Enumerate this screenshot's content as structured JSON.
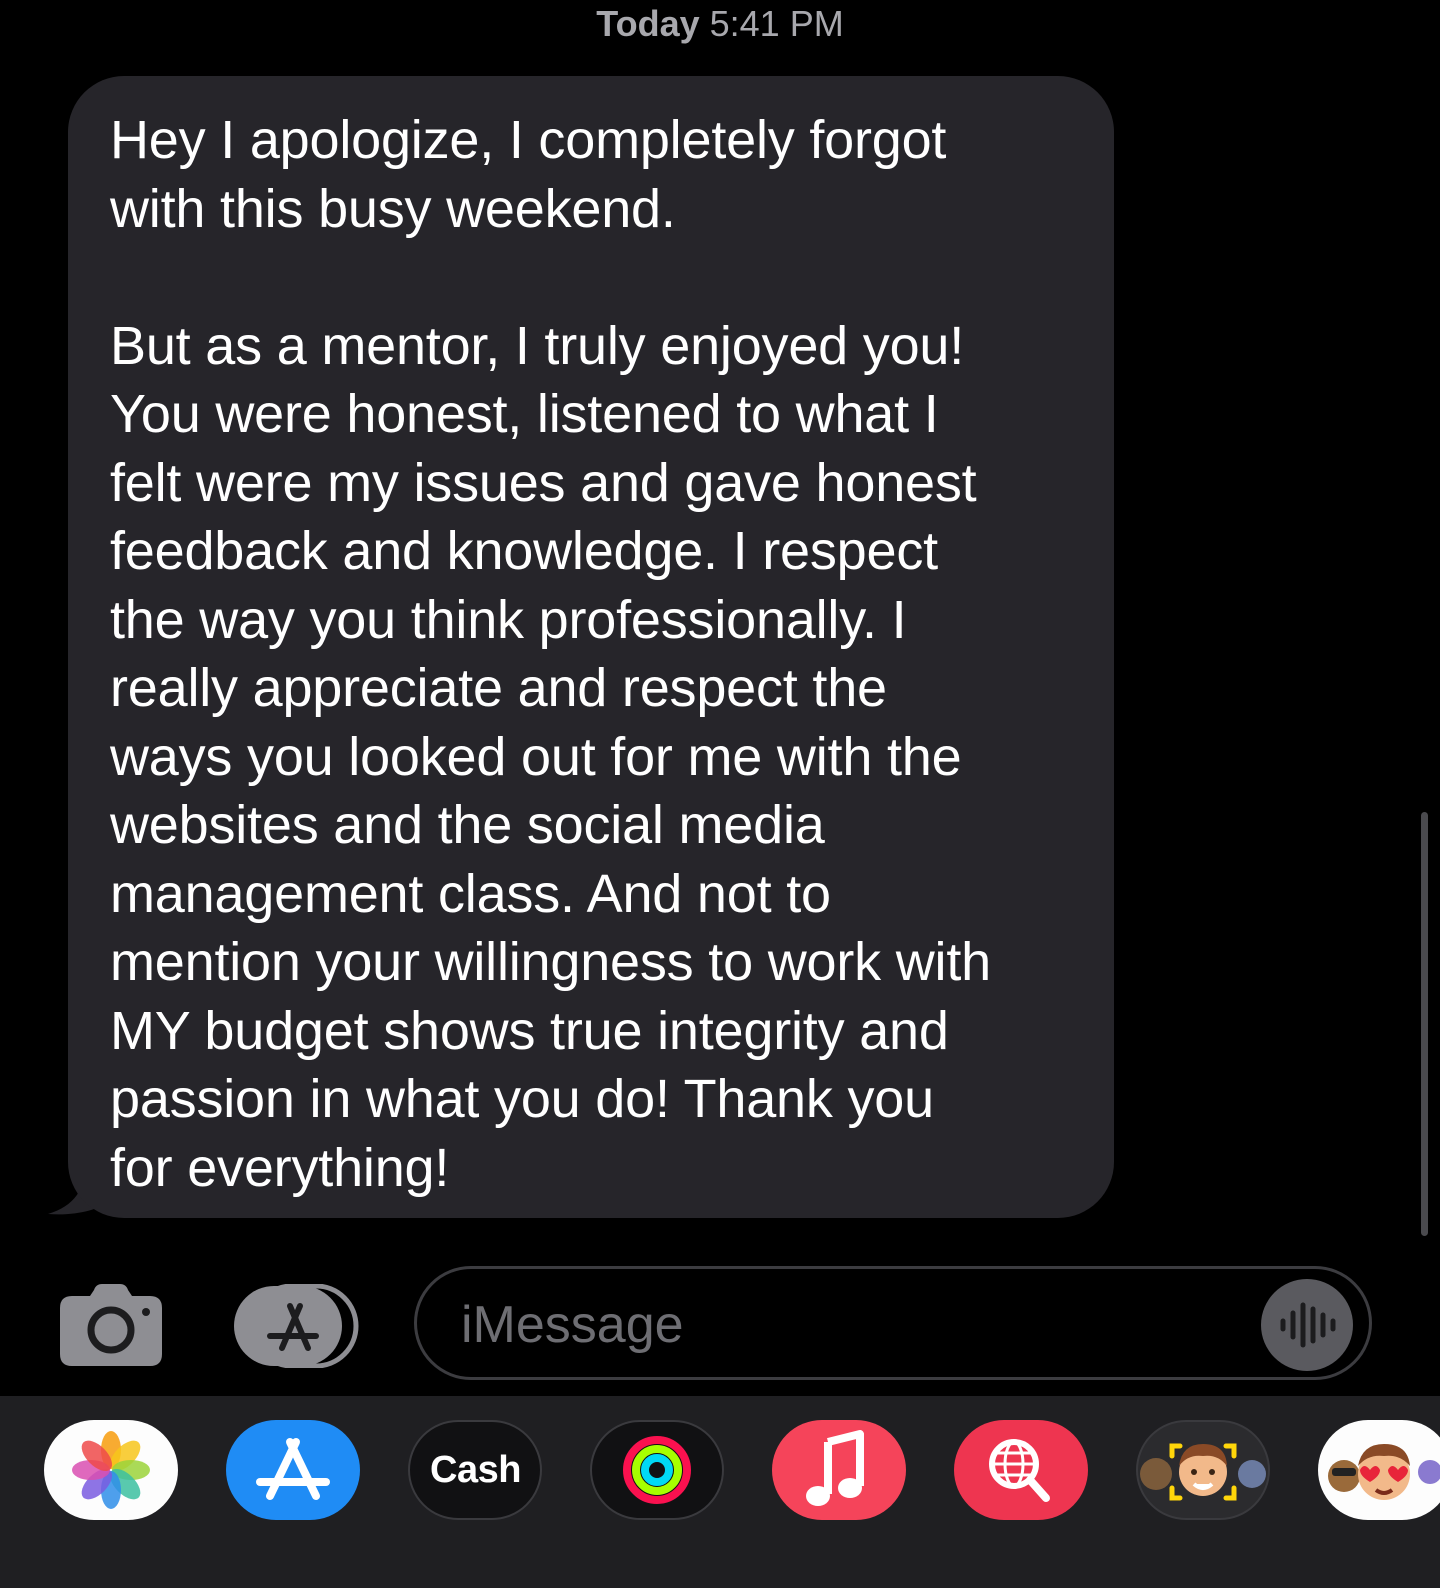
{
  "header": {
    "timestamp_day": "Today",
    "timestamp_time": "5:41 PM"
  },
  "message": {
    "text": "Hey I apologize, I completely forgot\nwith this busy weekend.\n\nBut as a mentor, I truly enjoyed you!\nYou were honest, listened to what I\nfelt were my issues and gave honest\nfeedback and knowledge. I respect\nthe way you think professionally. I\nreally appreciate and respect the\nways you looked out for me with the\nwebsites and the social media\nmanagement class. And not to\nmention your willingness to work with\nMY budget shows true integrity and\npassion in what you do! Thank you\nfor everything!",
    "bubble_color": "#26252a"
  },
  "composer": {
    "placeholder": "iMessage",
    "camera_icon": "camera-icon",
    "apps_icon": "app-store-icon",
    "audio_icon": "waveform-icon"
  },
  "app_drawer": {
    "items": [
      {
        "name": "photos",
        "icon": "photos-icon"
      },
      {
        "name": "app-store",
        "icon": "app-store-icon"
      },
      {
        "name": "cash",
        "icon": "apple-cash-icon",
        "label_symbol": "",
        "label": "Cash"
      },
      {
        "name": "fitness",
        "icon": "activity-rings-icon"
      },
      {
        "name": "music",
        "icon": "music-note-icon"
      },
      {
        "name": "images-search",
        "icon": "globe-search-icon"
      },
      {
        "name": "memoji",
        "icon": "memoji-icon"
      },
      {
        "name": "memoji-stickers",
        "icon": "memoji-stickers-icon"
      }
    ]
  },
  "colors": {
    "background": "#000000",
    "drawer_background": "#1f1f22",
    "timestamp": "#a8a8ad",
    "placeholder": "#6e6e73",
    "app_store_blue": "#1f8cf5",
    "music_red": "#f5445a",
    "search_red": "#ee3550"
  }
}
